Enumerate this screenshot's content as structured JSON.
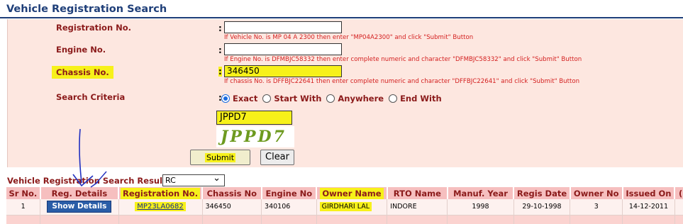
{
  "page": {
    "title": "Vehicle Registration Search"
  },
  "form": {
    "registration": {
      "label": "Registration No.",
      "value": "",
      "hint": "If Vehicle No. is MP 04 A 2300 then enter \"MP04A2300\" and click \"Submit\" Button"
    },
    "engine": {
      "label": "Engine No.",
      "value": "",
      "hint": "If Engine No. is DFMBJC58332 then enter complete numeric and character \"DFMBJC58332\" and click \"Submit\" Button"
    },
    "chassis": {
      "label": "Chassis No.",
      "value": "346450",
      "hint": "If chassis No. is DFFBJC22641 then enter complete numeric and character \"DFFBJC22641\" and click \"Submit\" Button"
    },
    "colon": ":",
    "search_criteria": {
      "label": "Search Criteria",
      "options": [
        "Exact",
        "Start With",
        "Anywhere",
        "End With"
      ],
      "selected": "Exact"
    },
    "captcha_input": "JPPD7",
    "captcha_image_text": "JPPD7",
    "submit_label": "Submit",
    "clear_label": "Clear"
  },
  "results": {
    "label": "Vehicle Registration Search Result :",
    "select_value": "RC",
    "columns": [
      "Sr No.",
      "Reg. Details",
      "Registration No.",
      "Chassis No",
      "Engine No",
      "Owner Name",
      "RTO Name",
      "Manuf. Year",
      "Regis Date",
      "Owner No",
      "Issued On",
      "("
    ],
    "rows": [
      {
        "sr": "1",
        "details_button": "Show Details",
        "registration": "MP23LA0682",
        "chassis": "346450",
        "engine": "340106",
        "owner": "GIRDHARI LAL",
        "rto": "INDORE",
        "manuf_year": "1998",
        "regis_date": "29-10-1998",
        "owner_no": "3",
        "issued_on": "14-12-2011"
      }
    ]
  },
  "colors": {
    "title": "#1f3f79",
    "label": "#8b1a1a",
    "hint": "#d42020",
    "form_bg": "#fde7e0",
    "highlight": "#f7f11a",
    "header_bg": "#f6bfbf",
    "button": "#2a5da7",
    "annotation_arrow": "#2030c0"
  }
}
